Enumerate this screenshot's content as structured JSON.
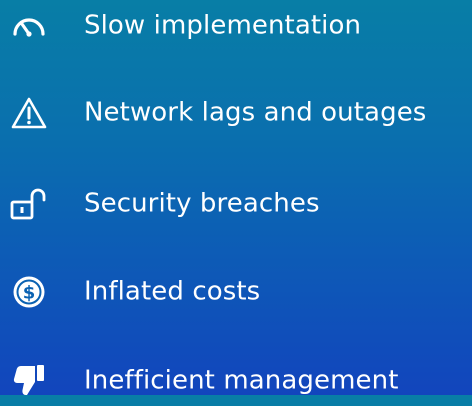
{
  "items": [
    {
      "icon": "speedometer-icon",
      "label": "Slow implementation"
    },
    {
      "icon": "warning-icon",
      "label": "Network lags and outages"
    },
    {
      "icon": "unlocked-padlock-icon",
      "label": "Security breaches"
    },
    {
      "icon": "dollar-coin-icon",
      "label": "Inflated costs"
    },
    {
      "icon": "thumbs-down-icon",
      "label": "Inefficient management"
    }
  ],
  "colors": {
    "text": "#ffffff",
    "background_top": "#087ea6",
    "background_bottom": "#1245bd"
  }
}
